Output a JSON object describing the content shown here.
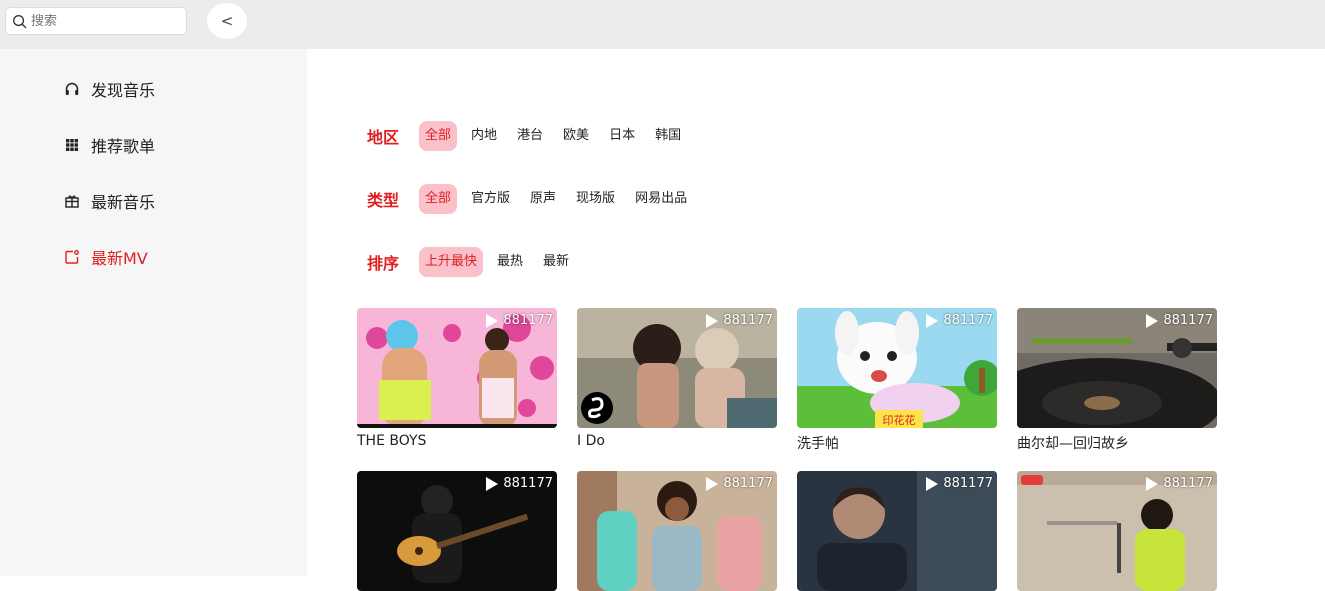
{
  "search": {
    "placeholder": "搜索"
  },
  "back_button": {
    "label": "<"
  },
  "sidebar": {
    "items": [
      {
        "label": "发现音乐",
        "icon": "headphones-icon"
      },
      {
        "label": "推荐歌单",
        "icon": "grid-icon"
      },
      {
        "label": "最新音乐",
        "icon": "gift-icon"
      },
      {
        "label": "最新MV",
        "icon": "video-share-icon",
        "active": true
      }
    ]
  },
  "filters": {
    "region": {
      "label": "地区",
      "options": [
        "全部",
        "内地",
        "港台",
        "欧美",
        "日本",
        "韩国"
      ],
      "selected": "全部"
    },
    "type": {
      "label": "类型",
      "options": [
        "全部",
        "官方版",
        "原声",
        "现场版",
        "网易出品"
      ],
      "selected": "全部"
    },
    "order": {
      "label": "排序",
      "options": [
        "上升最快",
        "最热",
        "最新"
      ],
      "selected": "上升最快"
    }
  },
  "mvs": [
    {
      "title": "THE BOYS",
      "play_count": "881177"
    },
    {
      "title": "I Do",
      "play_count": "881177"
    },
    {
      "title": "洗手帕",
      "play_count": "881177"
    },
    {
      "title": "曲尔却—回归故乡",
      "play_count": "881177"
    },
    {
      "title": "",
      "play_count": "881177"
    },
    {
      "title": "",
      "play_count": "881177"
    },
    {
      "title": "",
      "play_count": "881177"
    },
    {
      "title": "",
      "play_count": "881177"
    }
  ],
  "colors": {
    "accent": "#e02020",
    "tag_active_bg": "#fbc1cb",
    "topbar": "#ececec",
    "sidebar": "#f6f6f6"
  }
}
